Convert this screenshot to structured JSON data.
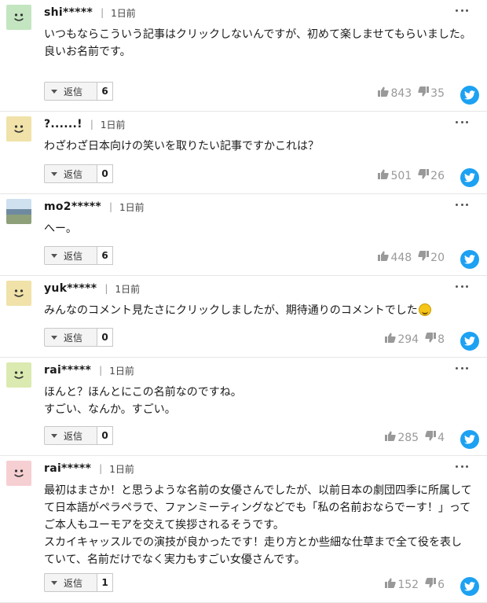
{
  "ui": {
    "reply_label": "返信",
    "icons": {
      "more": "more-dots-icon",
      "thumb_up": "thumbs-up-icon",
      "thumb_down": "thumbs-down-icon",
      "share": "twitter-icon",
      "reply_caret": "caret-down-icon"
    },
    "colors": {
      "twitter": "#1da1f2",
      "vote_text": "#999999",
      "border": "#e6e6e6"
    }
  },
  "comments": [
    {
      "username": "shi*****",
      "time": "1日前",
      "text": "いつもならこういう記事はクリックしないんですが、初めて楽しませてもらいました。\n良いお名前です。",
      "replies": "6",
      "likes": "843",
      "dislikes": "35",
      "avatar_color": "#c3e6c0"
    },
    {
      "username": "?......!",
      "time": "1日前",
      "text": "わざわざ日本向けの笑いを取りたい記事ですかこれは？",
      "replies": "0",
      "likes": "501",
      "dislikes": "26",
      "avatar_color": "#f0e2a8"
    },
    {
      "username": "mo2*****",
      "time": "1日前",
      "text": "へー。",
      "replies": "6",
      "likes": "448",
      "dislikes": "20",
      "avatar_color": "photo"
    },
    {
      "username": "yuk*****",
      "time": "1日前",
      "text": "みんなのコメント見たさにクリックしましたが、期待通りのコメントでした",
      "replies": "0",
      "likes": "294",
      "dislikes": "8",
      "avatar_color": "#f0e2a8"
    },
    {
      "username": "rai*****",
      "time": "1日前",
      "text": "ほんと？ほんとにこの名前なのですね。\nすごい、なんか。すごい。",
      "replies": "0",
      "likes": "285",
      "dislikes": "4",
      "avatar_color": "#dbeab0"
    },
    {
      "username": "rai*****",
      "time": "1日前",
      "text": "最初はまさか！と思うような名前の女優さんでしたが、以前日本の劇団四季に所属してて日本語がペラペラで、ファンミーティングなどでも「私の名前おならでーす！」ってご本人もユーモアを交えて挨拶されるそうです。\nスカイキャッスルでの演技が良かったです！走り方とか些細な仕草まで全て役を表していて、名前だけでなく実力もすごい女優さんです。",
      "replies": "1",
      "likes": "152",
      "dislikes": "6",
      "avatar_color": "#f6cfd2"
    }
  ]
}
